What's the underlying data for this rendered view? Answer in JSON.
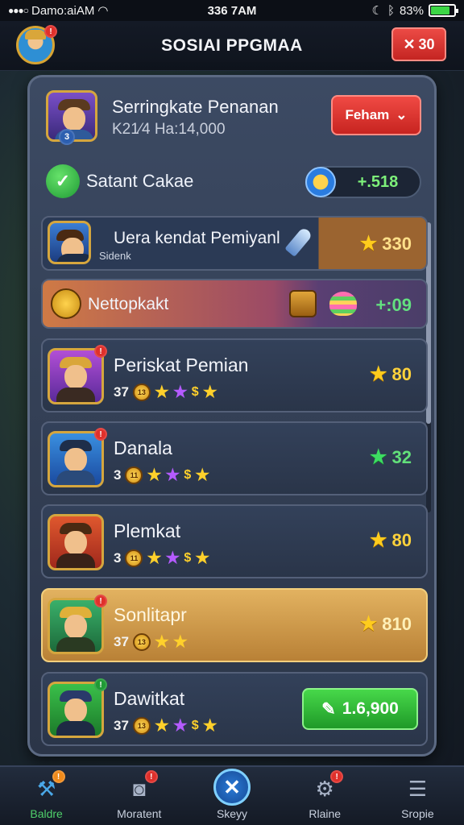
{
  "status_bar": {
    "carrier": "Damo:aiAM",
    "time": "336 7AM",
    "battery": "83%",
    "battery_level": 0.83
  },
  "header": {
    "title": "SOSIAI PPGMAA",
    "close_label": "30",
    "avatar_badge": "!"
  },
  "top_player": {
    "name": "Serringkate Penanan",
    "subtitle": "K21⁄4 Ha:14,000",
    "badge_num": "3",
    "dropdown_label": "Feham"
  },
  "chat": {
    "label": "Satant Cakae",
    "value": "+.518"
  },
  "highlight_rows": [
    {
      "name": "Uera kendat Pemiyanl",
      "sub": "Sidenk",
      "score": "330"
    },
    {
      "name": "Nettopkakt",
      "score": "+:09"
    }
  ],
  "players": [
    {
      "name": "Periskat Pemian",
      "stat": "37",
      "coin": "13",
      "score": "80",
      "star_color": "#ffcc1d",
      "score_color": "#ffd23b"
    },
    {
      "name": "Danala",
      "stat": "3",
      "coin": "11",
      "score": "32",
      "star_color": "#3ddc62",
      "score_color": "#62e07a"
    },
    {
      "name": "Plemkat",
      "stat": "3",
      "coin": "11",
      "score": "80",
      "star_color": "#ffcc1d",
      "score_color": "#ffd23b"
    },
    {
      "name": "Sonlitapr",
      "stat": "37",
      "coin": "13",
      "score": "810",
      "star_color": "#ffcc1d",
      "score_color": "#fff0b8"
    },
    {
      "name": "Dawitkat",
      "stat": "37",
      "coin": "13",
      "button": "1.6,900"
    }
  ],
  "nav": {
    "items": [
      {
        "label": "Baldre",
        "icon": "hammer-icon",
        "badge": "!"
      },
      {
        "label": "Moratent",
        "icon": "camera-icon",
        "badge": "!"
      },
      {
        "label": "Skeyy",
        "icon": "close-icon"
      },
      {
        "label": "Rlaine",
        "icon": "gear-icon",
        "badge": "!"
      },
      {
        "label": "Sropie",
        "icon": "menu-icon"
      }
    ]
  }
}
